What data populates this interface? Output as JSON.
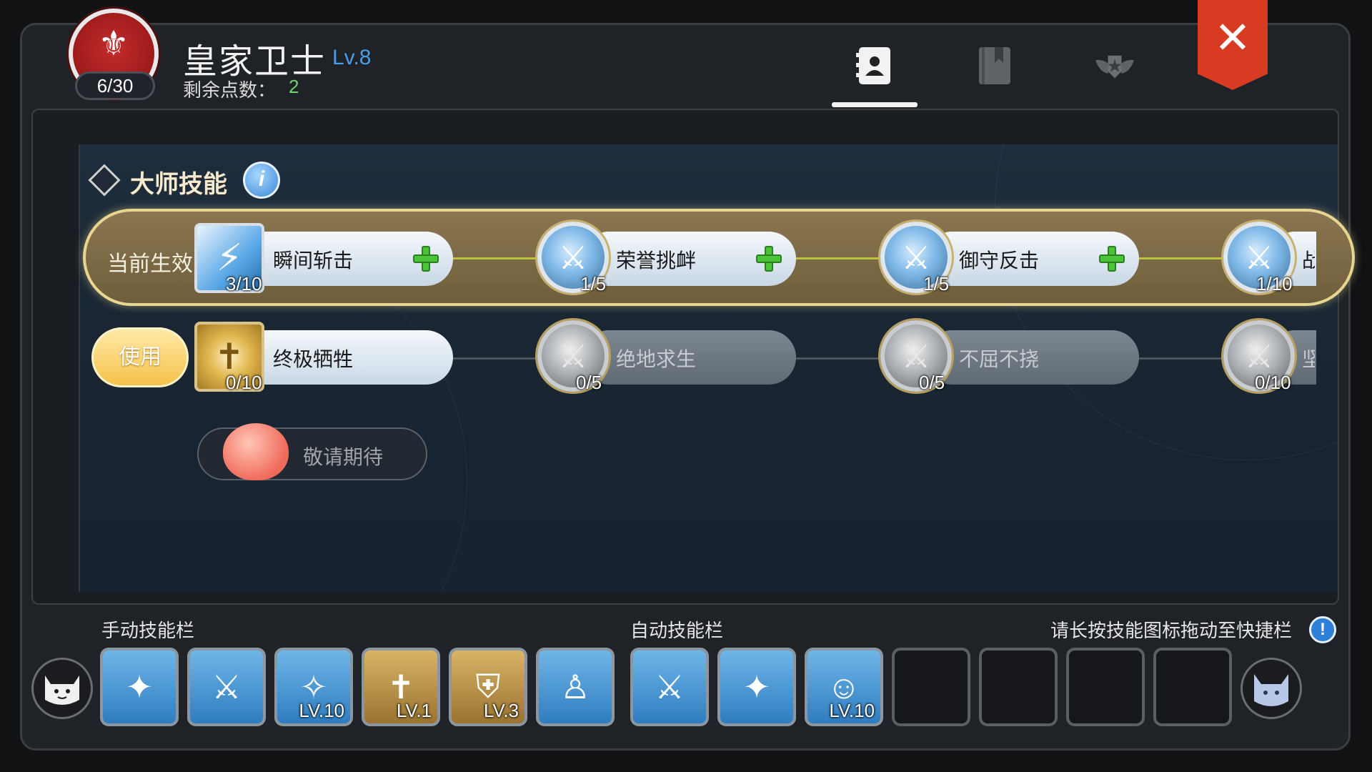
{
  "header": {
    "title": "皇家卫士",
    "level": "Lv.8",
    "progress": "6/30",
    "points_label": "剩余点数：",
    "points_value": "2",
    "tabs": [
      {
        "name": "profile-book",
        "active": true
      },
      {
        "name": "bookmark-book",
        "active": false
      },
      {
        "name": "emblem-star",
        "active": false
      }
    ],
    "close_label": "✕"
  },
  "section": {
    "title": "大师技能",
    "info_label": "i"
  },
  "active_row": {
    "label": "当前生效",
    "skills": [
      {
        "name": "瞬间斩击",
        "count": "3/10",
        "addable": true
      },
      {
        "name": "荣誉挑衅",
        "count": "1/5",
        "addable": true
      },
      {
        "name": "御守反击",
        "count": "1/5",
        "addable": true
      },
      {
        "name": "战",
        "count": "1/10",
        "addable": false
      }
    ]
  },
  "use_row": {
    "button": "使用",
    "skills": [
      {
        "name": "终极牺牲",
        "count": "0/10"
      },
      {
        "name": "绝地求生",
        "count": "0/5"
      },
      {
        "name": "不屈不挠",
        "count": "0/5"
      },
      {
        "name": "坚",
        "count": "0/10"
      }
    ]
  },
  "coming_soon": "敬请期待",
  "bottom": {
    "manual_label": "手动技能栏",
    "auto_label": "自动技能栏",
    "hint": "请长按技能图标拖动至快捷栏",
    "hint_icon": "!",
    "manual_slots": [
      {
        "icon": "sword-burst-icon",
        "lv": ""
      },
      {
        "icon": "sword-circle-icon",
        "lv": ""
      },
      {
        "icon": "sparkle-shield-icon",
        "lv": "LV.10"
      },
      {
        "icon": "cross-shield-icon",
        "lv": "LV.1"
      },
      {
        "icon": "heraldry-shield-icon",
        "lv": "LV.3"
      },
      {
        "icon": "figure-rotate-icon",
        "lv": ""
      }
    ],
    "auto_slots": [
      {
        "icon": "sword-circle-icon",
        "lv": ""
      },
      {
        "icon": "sword-burst-icon",
        "lv": ""
      },
      {
        "icon": "arms-up-figure-icon",
        "lv": "LV.10"
      },
      {
        "icon": "",
        "lv": ""
      },
      {
        "icon": "",
        "lv": ""
      },
      {
        "icon": "",
        "lv": ""
      },
      {
        "icon": "",
        "lv": ""
      }
    ]
  }
}
